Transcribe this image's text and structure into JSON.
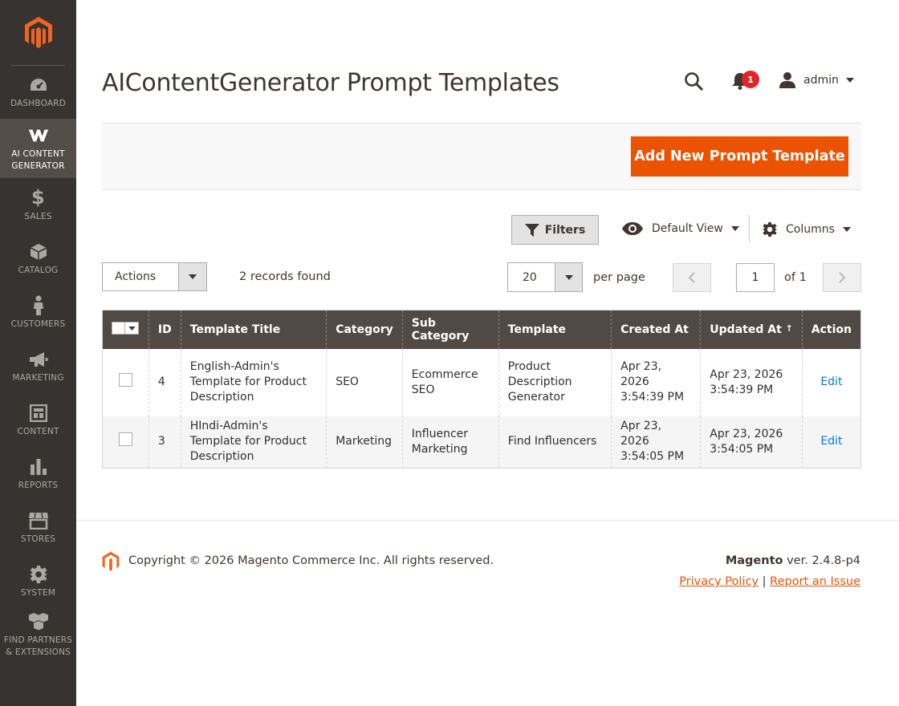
{
  "sidebar": {
    "items": [
      {
        "label": "DASHBOARD",
        "icon": "dashboard-icon"
      },
      {
        "label": "AI CONTENT GENERATOR",
        "icon": "ai-content-icon"
      },
      {
        "label": "SALES",
        "icon": "dollar-icon"
      },
      {
        "label": "CATALOG",
        "icon": "box-icon"
      },
      {
        "label": "CUSTOMERS",
        "icon": "person-icon"
      },
      {
        "label": "MARKETING",
        "icon": "megaphone-icon"
      },
      {
        "label": "CONTENT",
        "icon": "content-icon"
      },
      {
        "label": "REPORTS",
        "icon": "bar-chart-icon"
      },
      {
        "label": "STORES",
        "icon": "store-icon"
      },
      {
        "label": "SYSTEM",
        "icon": "gear-icon"
      },
      {
        "label": "FIND PARTNERS & EXTENSIONS",
        "icon": "extensions-icon"
      }
    ]
  },
  "header": {
    "title": "AIContentGenerator Prompt Templates",
    "notification_count": "1",
    "user": "admin"
  },
  "actions": {
    "add_label": "Add New Prompt Template"
  },
  "toolbar": {
    "filters_label": "Filters",
    "view_label": "Default View",
    "columns_label": "Columns",
    "actions_label": "Actions",
    "records_found": "2 records found",
    "per_page_value": "20",
    "per_page_label": "per page",
    "current_page": "1",
    "of_pages": "of 1"
  },
  "grid": {
    "columns": [
      "ID",
      "Template Title",
      "Category",
      "Sub Category",
      "Template",
      "Created At",
      "Updated At",
      "Action"
    ],
    "sort_indicator": "↑",
    "rows": [
      {
        "id": "4",
        "title": "English-Admin's Template for Product Description",
        "category": "SEO",
        "sub_category": "Ecommerce SEO",
        "template": "Product Description Generator",
        "created": "Apr 23, 2026 3:54:39 PM",
        "updated": "Apr 23, 2026 3:54:39 PM",
        "action": "Edit"
      },
      {
        "id": "3",
        "title": "HIndi-Admin's Template for Product Description",
        "category": "Marketing",
        "sub_category": "Influencer Marketing",
        "template": "Find Influencers",
        "created": "Apr 23, 2026 3:54:05 PM",
        "updated": "Apr 23, 2026 3:54:05 PM",
        "action": "Edit"
      }
    ]
  },
  "footer": {
    "copyright": "Copyright © 2026 Magento Commerce Inc. All rights reserved.",
    "brand": "Magento",
    "version": " ver. 2.4.8-p4",
    "privacy": "Privacy Policy",
    "separator": " | ",
    "report": "Report an Issue"
  },
  "colors": {
    "accent": "#eb5202",
    "sidebar": "#373330",
    "grid_header": "#514943",
    "link": "#007bdb"
  }
}
